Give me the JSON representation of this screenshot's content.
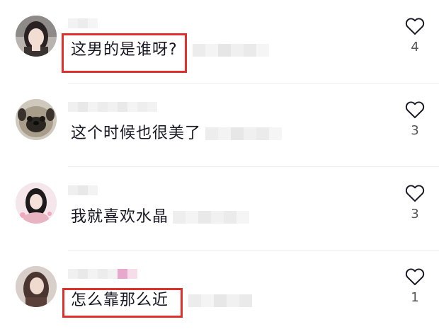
{
  "comments": [
    {
      "text": "这男的是谁呀?",
      "likes": "4",
      "highlighted": true,
      "avatar": "girl-portrait-avatar",
      "accent": "#e0302b"
    },
    {
      "text": "这个时候也很美了",
      "likes": "3",
      "highlighted": false,
      "avatar": "pug-dog-avatar"
    },
    {
      "text": "我就喜欢水晶",
      "likes": "3",
      "highlighted": false,
      "avatar": "woman-pink-avatar"
    },
    {
      "text": "怎么靠那么近",
      "likes": "1",
      "highlighted": true,
      "avatar": "long-hair-girl-avatar",
      "accent": "#e0302b"
    }
  ],
  "icons": {
    "like": "heart-outline-icon"
  }
}
